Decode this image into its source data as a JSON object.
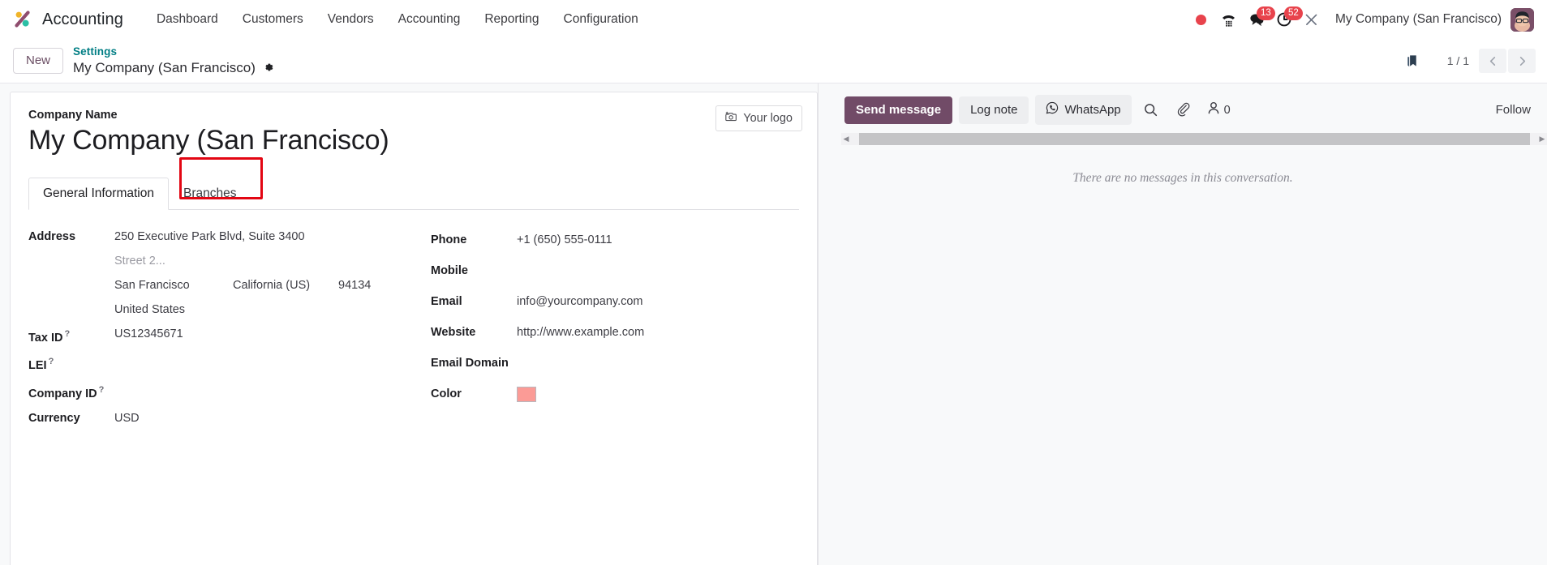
{
  "navbar": {
    "brand": "Accounting",
    "brand_logo_icon": "odoo-logo-icon",
    "menus": [
      {
        "label": "Dashboard"
      },
      {
        "label": "Customers"
      },
      {
        "label": "Vendors"
      },
      {
        "label": "Accounting"
      },
      {
        "label": "Reporting"
      },
      {
        "label": "Configuration"
      }
    ],
    "systray": {
      "record_icon": "record-dot-icon",
      "voip_icon": "phone-dialpad-icon",
      "messages_icon": "messages-icon",
      "messages_badge": "13",
      "activities_icon": "activity-clock-icon",
      "activities_badge": "52",
      "debug_icon": "wrench-tools-icon"
    },
    "user_company": "My Company (San Francisco)",
    "avatar_icon": "user-avatar"
  },
  "controlpanel": {
    "new_button": "New",
    "breadcrumb_parent": "Settings",
    "breadcrumb_current": "My Company (San Francisco)",
    "settings_gear_icon": "gear-icon",
    "bookmark_icon": "bookmark-icon",
    "pager": "1 / 1",
    "prev_icon": "chevron-left-icon",
    "next_icon": "chevron-right-icon"
  },
  "form": {
    "logo_button": "Your logo",
    "logo_button_icon": "camera-add-icon",
    "company_name_label": "Company Name",
    "company_name_value": "My Company (San Francisco)",
    "tabs": [
      {
        "label": "General Information",
        "active": true
      },
      {
        "label": "Branches",
        "active": false,
        "highlighted": true
      }
    ],
    "left_fields": {
      "address_label": "Address",
      "street": "250 Executive Park Blvd, Suite 3400",
      "street2_placeholder": "Street 2...",
      "city": "San Francisco",
      "state": "California (US)",
      "zip": "94134",
      "country": "United States",
      "tax_id_label": "Tax ID",
      "tax_id_value": "US12345671",
      "lei_label": "LEI",
      "lei_value": "",
      "company_id_label": "Company ID",
      "company_id_value": "",
      "currency_label": "Currency",
      "currency_value": "USD",
      "help_marker": "?"
    },
    "right_fields": {
      "phone_label": "Phone",
      "phone_value": "+1 (650) 555-0111",
      "mobile_label": "Mobile",
      "mobile_value": "",
      "email_label": "Email",
      "email_value": "info@yourcompany.com",
      "website_label": "Website",
      "website_value": "http://www.example.com",
      "email_domain_label": "Email Domain",
      "email_domain_value": "",
      "color_label": "Color",
      "color_value": "#FB9B96"
    }
  },
  "chatter": {
    "send_message": "Send message",
    "log_note": "Log note",
    "whatsapp": "WhatsApp",
    "whatsapp_icon": "whatsapp-icon",
    "search_icon": "search-icon",
    "attachment_icon": "paperclip-icon",
    "followers_icon": "user-follower-icon",
    "followers_count": "0",
    "follow_button": "Follow",
    "empty_message": "There are no messages in this conversation."
  },
  "colors": {
    "brand_purple": "#714B67",
    "teal_link": "#017E84",
    "badge_red": "#E8434C",
    "highlight_red": "#E30613"
  }
}
